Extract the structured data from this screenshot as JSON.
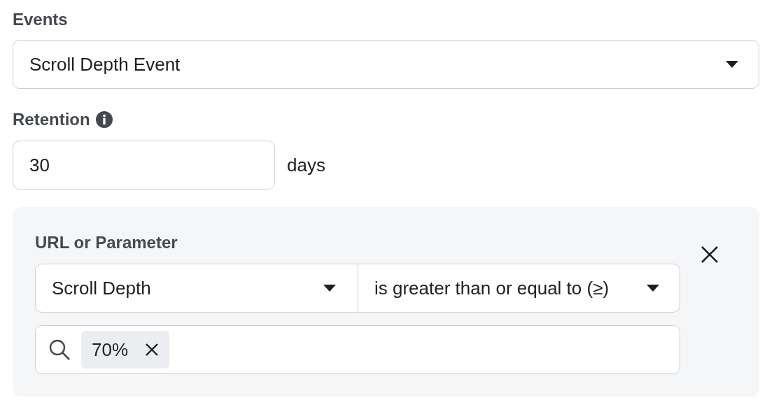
{
  "events": {
    "label": "Events",
    "value": "Scroll Depth Event"
  },
  "retention": {
    "label": "Retention",
    "value": "30",
    "unit": "days"
  },
  "rule": {
    "label": "URL or Parameter",
    "field": "Scroll Depth",
    "operator": "is greater than or equal to (≥)",
    "tags": [
      {
        "label": "70%"
      }
    ]
  }
}
